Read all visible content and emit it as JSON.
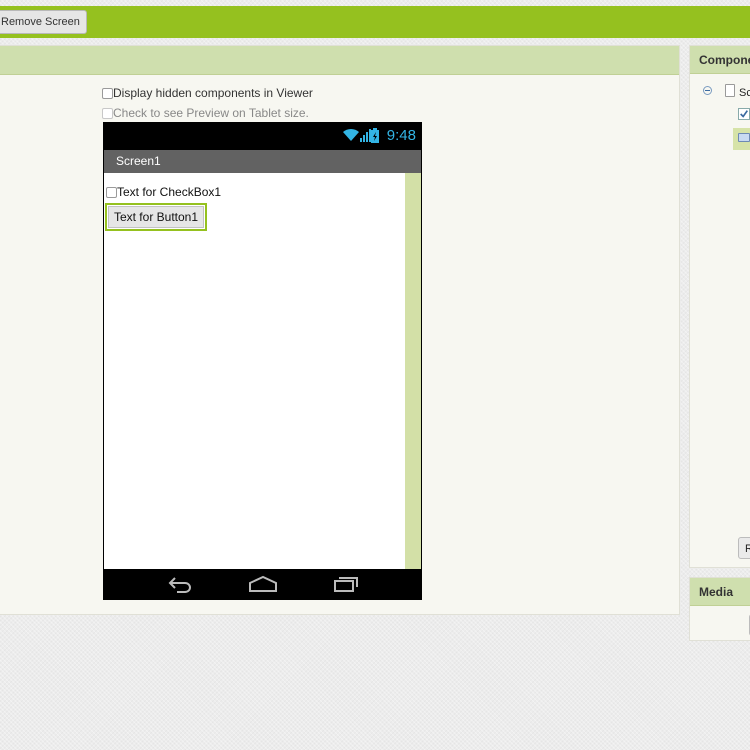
{
  "toolbar": {
    "remove_screen_label": "Remove Screen",
    "accent_color": "#95c11f"
  },
  "viewer": {
    "display_hidden_label": "Display hidden components in Viewer",
    "display_hidden_checked": false,
    "tablet_preview_label": "Check to see Preview on Tablet size.",
    "tablet_preview_checked": false,
    "header_color": "#cfdfae"
  },
  "phone": {
    "status_time": "9:48",
    "status_icons": [
      "wifi-icon",
      "signal-icon",
      "battery-icon"
    ],
    "screen_title": "Screen1",
    "checkbox1_label": "Text for CheckBox1",
    "checkbox1_checked": false,
    "button1_label": "Text for Button1",
    "nav_icons": [
      "back-icon",
      "home-icon",
      "recent-apps-icon"
    ]
  },
  "components": {
    "title": "Compone",
    "tree_screen_label": "Sc",
    "rename_label": "R"
  },
  "media": {
    "title": "Media"
  }
}
